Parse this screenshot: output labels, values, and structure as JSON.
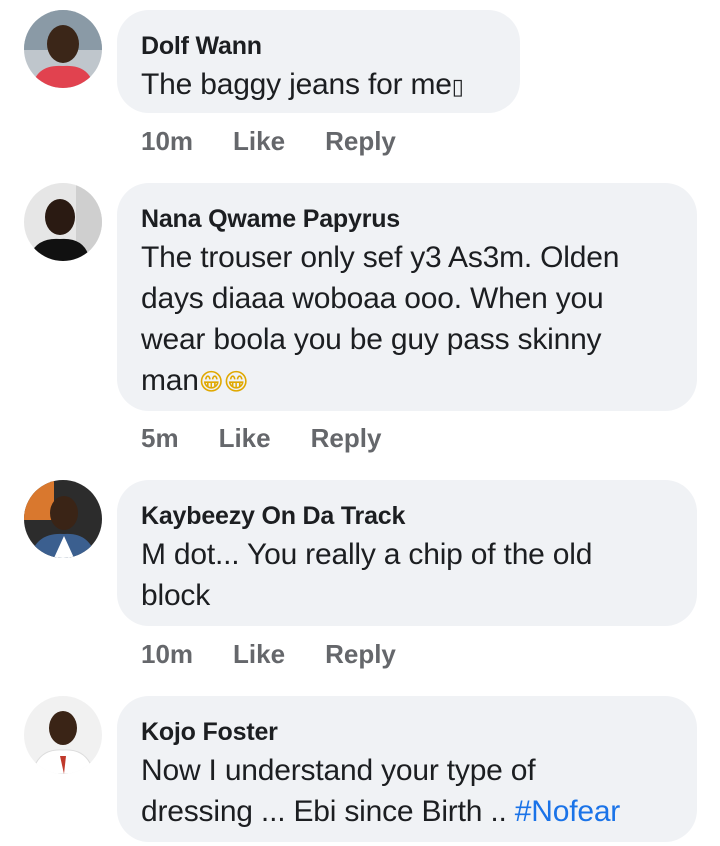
{
  "comments": [
    {
      "author": "Dolf Wann",
      "text": "The baggy jeans for me",
      "text_suffix": "▯",
      "time": "10m",
      "like": "Like",
      "reply": "Reply"
    },
    {
      "author": "Nana Qwame Papyrus",
      "text_lines": [
        "The trouser only sef y3 As3m. Olden",
        "days diaaa woboaa ooo. When you",
        "wear boola you be guy pass skinny",
        "man"
      ],
      "emoji": "😁😁",
      "time": "5m",
      "like": "Like",
      "reply": "Reply"
    },
    {
      "author": "Kaybeezy On Da Track",
      "text_lines": [
        "M dot... You really a chip of the old",
        "block"
      ],
      "time": "10m",
      "like": "Like",
      "reply": "Reply"
    },
    {
      "author": "Kojo Foster",
      "text_lines": [
        "Now I understand your type of",
        "dressing ... Ebi since Birth .. "
      ],
      "hashtag": "#Nofear",
      "time": "",
      "like": "",
      "reply": ""
    }
  ],
  "colors": {
    "bubble": "#f0f2f5",
    "text": "#1c1e21",
    "meta": "#65676b",
    "hashtag": "#1a73e8"
  }
}
